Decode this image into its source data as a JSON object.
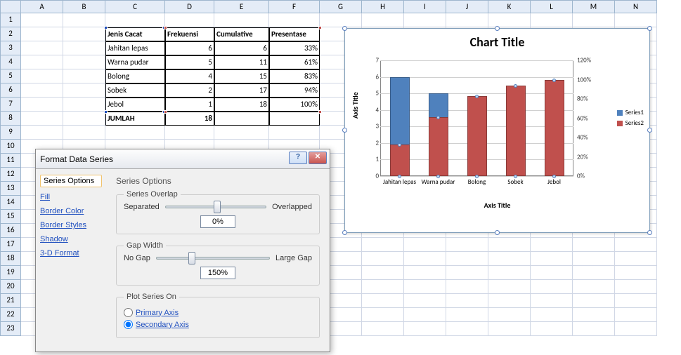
{
  "columns": [
    "A",
    "B",
    "C",
    "D",
    "E",
    "F",
    "G",
    "H",
    "I",
    "J",
    "K",
    "L",
    "M",
    "N"
  ],
  "rows": 23,
  "table": {
    "headers": [
      "Jenis Cacat",
      "Frekuensi",
      "Cumulative",
      "Presentase"
    ],
    "rows": [
      {
        "jenis": "Jahitan lepas",
        "frek": "6",
        "cum": "6",
        "pct": "33%"
      },
      {
        "jenis": "Warna pudar",
        "frek": "5",
        "cum": "11",
        "pct": "61%"
      },
      {
        "jenis": "Bolong",
        "frek": "4",
        "cum": "15",
        "pct": "83%"
      },
      {
        "jenis": "Sobek",
        "frek": "2",
        "cum": "17",
        "pct": "94%"
      },
      {
        "jenis": "Jebol",
        "frek": "1",
        "cum": "18",
        "pct": "100%"
      }
    ],
    "total_label": "JUMLAH",
    "total_value": "18"
  },
  "dialog": {
    "title": "Format Data Series",
    "nav": [
      "Series Options",
      "Fill",
      "Border Color",
      "Border Styles",
      "Shadow",
      "3-D Format"
    ],
    "heading": "Series Options",
    "overlap": {
      "legend": "Series Overlap",
      "left": "Separated",
      "right": "Overlapped",
      "value": "0%"
    },
    "gap": {
      "legend": "Gap Width",
      "left": "No Gap",
      "right": "Large Gap",
      "value": "150%"
    },
    "plot": {
      "legend": "Plot Series On",
      "primary": "Primary Axis",
      "secondary": "Secondary Axis"
    }
  },
  "chart_data": {
    "type": "bar",
    "title": "Chart Title",
    "xlabel": "Axis Title",
    "ylabel": "Axis Title",
    "categories": [
      "Jahitan lepas",
      "Warna pudar",
      "Bolong",
      "Sobek",
      "Jebol"
    ],
    "series": [
      {
        "name": "Series1",
        "values": [
          6,
          5,
          4,
          2,
          1
        ],
        "axis": "primary"
      },
      {
        "name": "Series2",
        "values": [
          0.33,
          0.61,
          0.83,
          0.94,
          1.0
        ],
        "axis": "secondary"
      }
    ],
    "ylim": [
      0,
      7
    ],
    "yticks": [
      0,
      1,
      2,
      3,
      4,
      5,
      6,
      7
    ],
    "y2lim": [
      0,
      1.2
    ],
    "y2ticks": [
      "0%",
      "20%",
      "40%",
      "60%",
      "80%",
      "100%",
      "120%"
    ],
    "legend": [
      "Series1",
      "Series2"
    ]
  }
}
